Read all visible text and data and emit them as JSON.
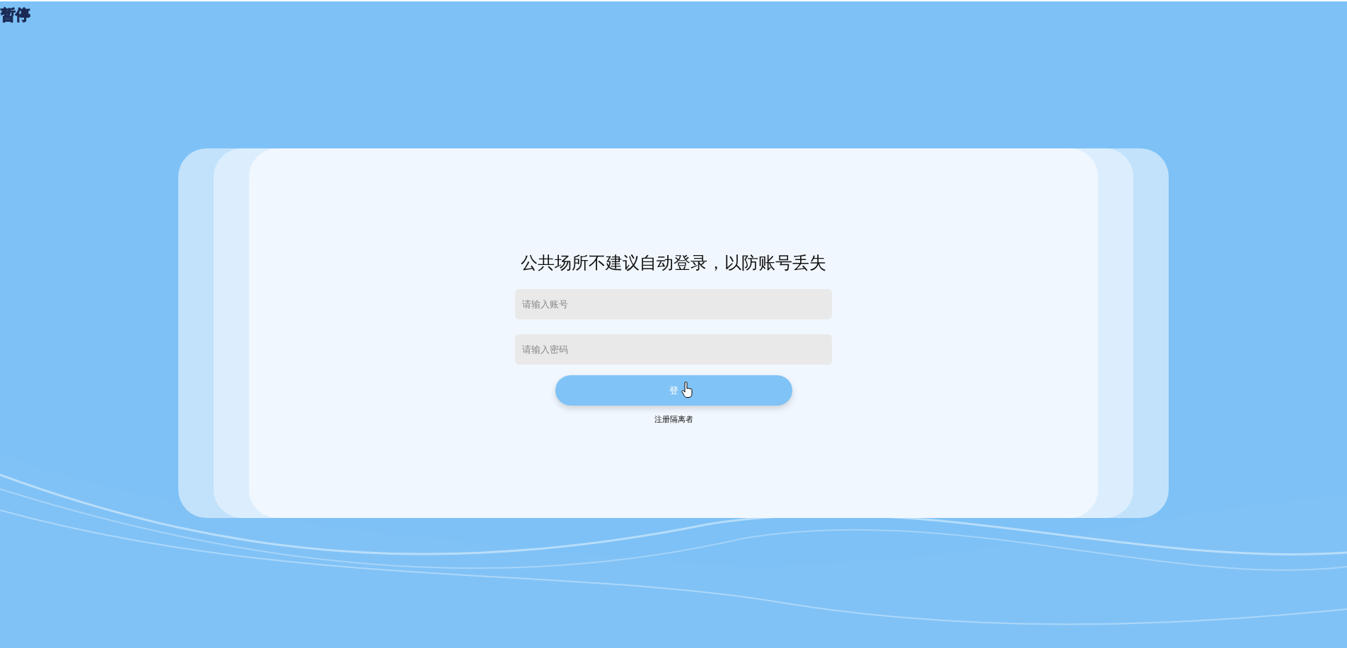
{
  "pause_label": "暂停",
  "login": {
    "title": "公共场所不建议自动登录，以防账号丢失",
    "fields": [
      {
        "placeholder": "请输入账号"
      },
      {
        "placeholder": "请输入密码"
      }
    ],
    "submit_button": "登",
    "register_link": "注册隔离者"
  }
}
